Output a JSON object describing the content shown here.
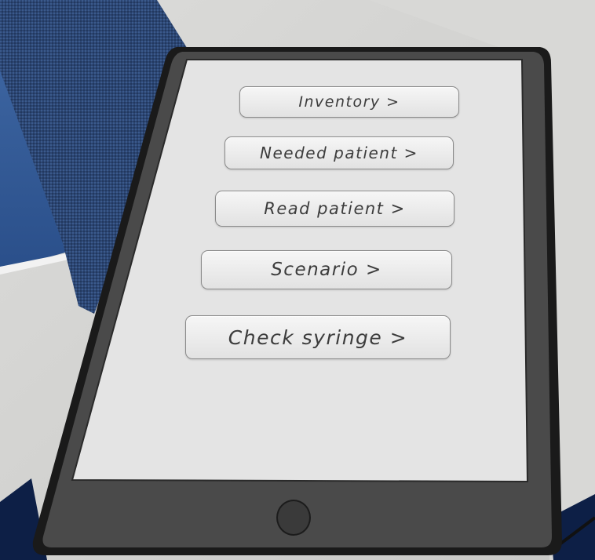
{
  "tablet_menu": {
    "buttons": [
      {
        "label": "Inventory >"
      },
      {
        "label": "Needed patient >"
      },
      {
        "label": "Read patient >"
      },
      {
        "label": "Scenario >"
      },
      {
        "label": "Check syringe >"
      }
    ]
  },
  "colors": {
    "tablet_frame": "#4a4a4a",
    "tablet_edge": "#1a1a1a",
    "screen": "#e3e3e3",
    "button_bg": "#ececec",
    "button_text": "#3c3c3c",
    "wall": "#d4d4d2",
    "fabric": "#2e4a78",
    "floor": "#0d1f46"
  },
  "icons": {
    "home": "home-button-icon"
  }
}
